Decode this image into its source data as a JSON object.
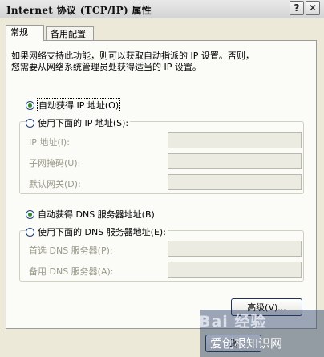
{
  "window": {
    "title": "Internet 协议 (TCP/IP) 属性",
    "help_glyph": "?",
    "close_glyph": "✕"
  },
  "tabs": [
    {
      "label": "常规",
      "active": true
    },
    {
      "label": "备用配置",
      "active": false
    }
  ],
  "description": [
    "如果网络支持此功能，则可以获取自动指派的 IP 设置。否则，",
    "您需要从网络系统管理员处获得适当的 IP 设置。"
  ],
  "ip_section": {
    "auto_label": "自动获得 IP 地址(O)",
    "auto_checked": true,
    "manual_label": "使用下面的 IP 地址(S):",
    "manual_checked": false,
    "fields": [
      {
        "label": "IP 地址(I):",
        "value": ""
      },
      {
        "label": "子网掩码(U):",
        "value": ""
      },
      {
        "label": "默认网关(D):",
        "value": ""
      }
    ]
  },
  "dns_section": {
    "auto_label": "自动获得 DNS 服务器地址(B)",
    "auto_checked": true,
    "manual_label": "使用下面的 DNS 服务器地址(E):",
    "manual_checked": false,
    "fields": [
      {
        "label": "首选 DNS 服务器(P):",
        "value": ""
      },
      {
        "label": "备用 DNS 服务器(A):",
        "value": ""
      }
    ]
  },
  "buttons": {
    "advanced": "高级(V)...",
    "ok": "确"
  },
  "watermark": {
    "logo": "Bai 经验",
    "text": "爱创根知识网"
  }
}
